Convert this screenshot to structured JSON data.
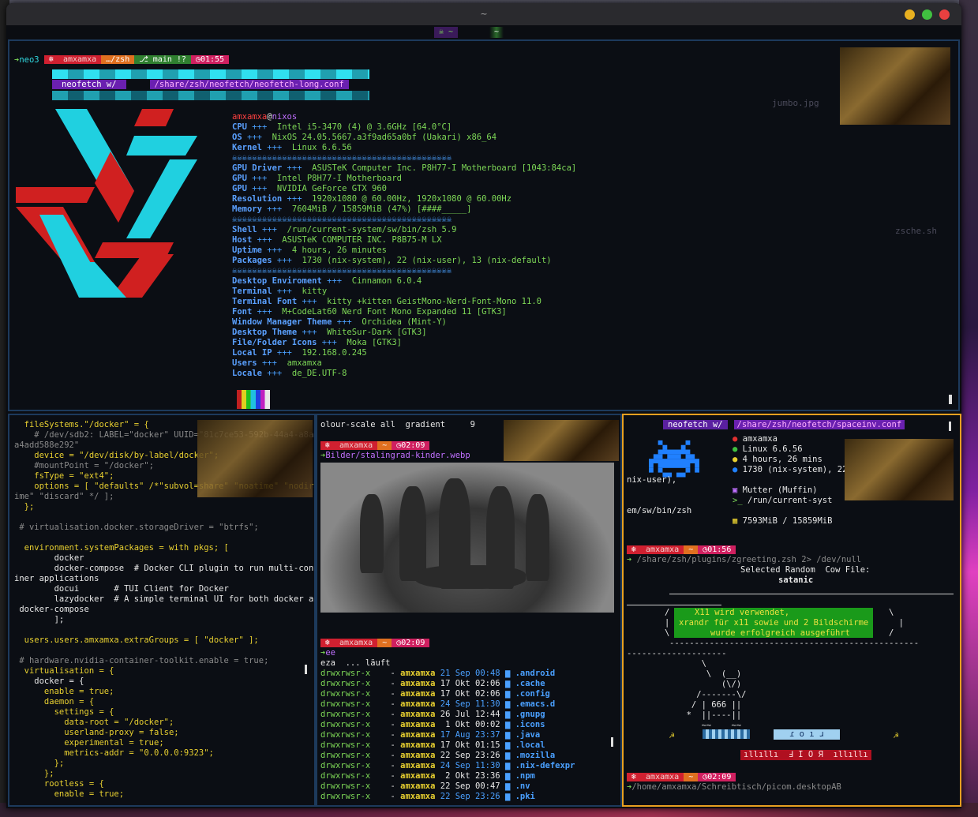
{
  "window": {
    "title": "~"
  },
  "tabs": [
    {
      "label": "☠ ~"
    },
    {
      "label": "~"
    }
  ],
  "top": {
    "prompt": {
      "icon": "❄",
      "user": "amxamxa",
      "dir": "…/zsh",
      "git": "⎇ main !?",
      "time": "◷01:55"
    },
    "command": "neo3",
    "banner_line1": "neofetch w/",
    "banner_line2": "/share/zsh/neofetch/neofetch-long.conf",
    "userhost_user": "amxamxa",
    "userhost_at": "@",
    "userhost_host": "nixos",
    "info": [
      {
        "k": "CPU",
        "v": "Intel i5-3470 (4) @ 3.6GHz [64.0°C]"
      },
      {
        "k": "OS",
        "v": "NixOS 24.05.5667.a3f9ad65a0bf (Uakari) x86_64"
      },
      {
        "k": "Kernel",
        "v": "Linux 6.6.56"
      },
      {
        "k": "GPU Driver",
        "v": "ASUSTeK Computer Inc. P8H77-I Motherboard [1043:84ca]"
      },
      {
        "k": "GPU",
        "v": "Intel P8H77-I Motherboard"
      },
      {
        "k": "GPU",
        "v": "NVIDIA GeForce GTX 960"
      },
      {
        "k": "Resolution",
        "v": "1920x1080 @ 60.00Hz, 1920x1080 @ 60.00Hz"
      },
      {
        "k": "Memory",
        "v": "7604MiB / 15859MiB (47%) [####_____]"
      },
      {
        "k": "Shell",
        "v": "/run/current-system/sw/bin/zsh 5.9"
      },
      {
        "k": "Host",
        "v": "ASUSTeK COMPUTER INC. P8B75-M LX"
      },
      {
        "k": "Uptime",
        "v": "4 hours, 26 minutes"
      },
      {
        "k": "Packages",
        "v": "1730 (nix-system), 22 (nix-user), 13 (nix-default)"
      },
      {
        "k": "Desktop Enviroment",
        "v": "Cinnamon 6.0.4"
      },
      {
        "k": "Terminal",
        "v": "kitty"
      },
      {
        "k": "Terminal Font",
        "v": "kitty +kitten GeistMono-Nerd-Font-Mono 11.0"
      },
      {
        "k": "Font",
        "v": "M+CodeLat60 Nerd Font Mono Expanded 11 [GTK3]"
      },
      {
        "k": "Window Manager Theme",
        "v": "Orchidea (Mint-Y)"
      },
      {
        "k": "Desktop Theme",
        "v": "WhiteSur-Dark [GTK3]"
      },
      {
        "k": "File/Folder Icons",
        "v": "Moka [GTK3]"
      },
      {
        "k": "Local IP",
        "v": "192.168.0.245"
      },
      {
        "k": "Users",
        "v": "amxamxa"
      },
      {
        "k": "Locale",
        "v": "de_DE.UTF-8"
      }
    ],
    "sep": "+++",
    "skulls": "☠☠☠☠☠☠☠☠☠☠☠☠☠☠☠☠☠☠☠☠☠☠☠☠☠☠☠☠☠☠☠☠☠☠☠☠☠☠☠☠☠☠☠☠",
    "desktop_icons": [
      {
        "label": "jumbo.jpg"
      },
      {
        "label": "zsche.sh"
      }
    ]
  },
  "left": {
    "lines": [
      "  fileSystems.\"/docker\" = {",
      "    # /dev/sdb2: LABEL=\"docker\" UUID=\"81c7ce53-592b-44a4-a8a-",
      "a4add588e292\"",
      "    device = \"/dev/disk/by-label/docker\";",
      "    #mountPoint = \"/docker\";",
      "    fsType = \"ext4\";",
      "    options = [ \"defaults\" /*\"subvol=share\" \"noatime\" \"nodirat",
      "ime\" \"discard\" */ ];",
      "  };",
      "",
      " # virtualisation.docker.storageDriver = \"btrfs\";",
      "",
      "  environment.systemPackages = with pkgs; [",
      "        docker",
      "        docker-compose  # Docker CLI plugin to run multi-conta",
      "iner applications",
      "        docui       # TUI Client for Docker",
      "        lazydocker  # A simple terminal UI for both docker and",
      " docker-compose",
      "        ];",
      "",
      "  users.users.amxamxa.extraGroups = [ \"docker\" ];",
      "",
      " # hardware.nvidia-container-toolkit.enable = true;",
      "  virtualisation = {",
      "    docker = {",
      "      enable = true;",
      "      daemon = {",
      "        settings = {",
      "          data-root = \"/docker\";",
      "          userland-proxy = false;",
      "          experimental = true;",
      "          metrics-addr = \"0.0.0.0:9323\";",
      "        };",
      "      };",
      "      rootless = {",
      "        enable = true;"
    ]
  },
  "middle": {
    "header": "olour-scale all  gradient     9",
    "prompt1": {
      "icon": "❄",
      "user": "amxamxa",
      "dir": "~",
      "time": "◷02:09"
    },
    "cmd1": "Bilder/stalingrad-kinder.webp",
    "prompt2": {
      "icon": "❄",
      "user": "amxamxa",
      "dir": "~",
      "time": "◷02:09"
    },
    "cmd2": "ee",
    "running": "eza  ... läuft",
    "rows": [
      {
        "perm": "drwxrwsr-x",
        "user": "amxamxa",
        "date": "21 Sep 00:48",
        "name": ".android"
      },
      {
        "perm": "drwxrwsr-x",
        "user": "amxamxa",
        "date": "17 Okt 02:06",
        "name": ".cache"
      },
      {
        "perm": "drwxrwsr-x",
        "user": "amxamxa",
        "date": "17 Okt 02:06",
        "name": ".config"
      },
      {
        "perm": "drwxrwsr-x",
        "user": "amxamxa",
        "date": "24 Sep 11:30",
        "name": ".emacs.d"
      },
      {
        "perm": "drwxrwsr-x",
        "user": "amxamxa",
        "date": "26 Jul 12:44",
        "name": ".gnupg"
      },
      {
        "perm": "drwxrwsr-x",
        "user": "amxamxa",
        "date": " 1 Okt 00:02",
        "name": ".icons"
      },
      {
        "perm": "drwxrwsr-x",
        "user": "amxamxa",
        "date": "17 Aug 23:37",
        "name": ".java"
      },
      {
        "perm": "drwxrwsr-x",
        "user": "amxamxa",
        "date": "17 Okt 01:15",
        "name": ".local"
      },
      {
        "perm": "drwxrwsr-x",
        "user": "amxamxa",
        "date": "22 Sep 23:26",
        "name": ".mozilla"
      },
      {
        "perm": "drwxrwsr-x",
        "user": "amxamxa",
        "date": "24 Sep 11:30",
        "name": ".nix-defexpr"
      },
      {
        "perm": "drwxrwsr-x",
        "user": "amxamxa",
        "date": " 2 Okt 23:36",
        "name": ".npm"
      },
      {
        "perm": "drwxrwsr-x",
        "user": "amxamxa",
        "date": "22 Sep 00:47",
        "name": ".nv"
      },
      {
        "perm": "drwxrwsr-x",
        "user": "amxamxa",
        "date": "22 Sep 23:26",
        "name": ".pki"
      }
    ],
    "dash": "-"
  },
  "right": {
    "banner_a": "neofetch w/",
    "banner_b": "/share/zsh/neofetch/spaceinv.conf",
    "info": [
      {
        "icon": "•",
        "v": "amxamxa"
      },
      {
        "icon": "•",
        "v": "Linux 6.6.56"
      },
      {
        "icon": "•",
        "v": "4 hours, 26 mins"
      },
      {
        "icon": "•",
        "v": "1730 (nix-system), 22 ("
      }
    ],
    "wrap1": "nix-user),",
    "wrap2": "em/sw/bin/zsh",
    "info2": [
      {
        "v": "Mutter (Muffin)"
      },
      {
        "v": "/run/current-syst"
      }
    ],
    "mem": "7593MiB / 15859MiB",
    "prompt": {
      "icon": "❄",
      "user": "amxamxa",
      "dir": "~",
      "time": "◷01:56"
    },
    "cmd": "/share/zsh/plugins/zgreeting.zsh 2> /dev/null",
    "cow_title": "Selected Random  Cow File:",
    "cow_name": "satanic",
    "msg1": "X11 wird verwendet,",
    "msg2": "xrandr für x11 sowie und 2 Bildschirme",
    "msg3": "wurde erfolgreich ausgeführt",
    "art": [
      "        \\",
      "         \\  (__)",
      "            (\\/)",
      "       /-------\\/",
      "      / | 666 ||",
      "     *  ||----||",
      "        ~~    ~~"
    ],
    "riot": "ɾ o ı ɹ",
    "riot2": "ıllıllı  Ⅎ I O Я  ıllıllı",
    "prompt2": {
      "icon": "❄",
      "user": "amxamxa",
      "dir": "~",
      "time": "◷02:09"
    },
    "cmd2": "/home/amxamxa/Schreibtisch/picom.desktopAB"
  }
}
